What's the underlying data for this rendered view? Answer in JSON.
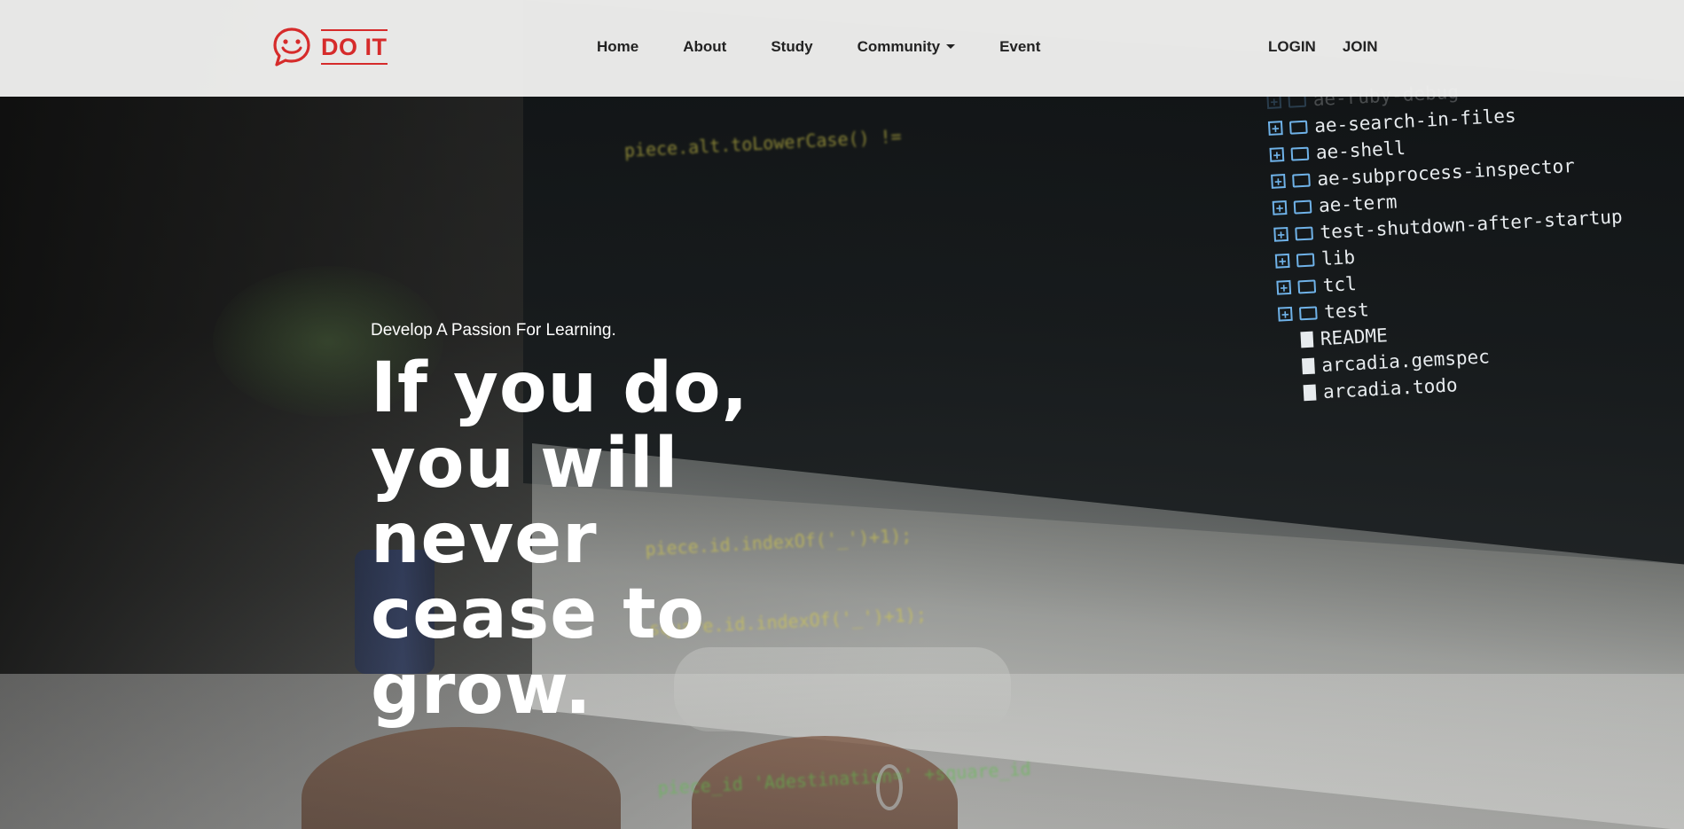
{
  "brand": {
    "name": "DO IT",
    "color": "#d62b2b"
  },
  "nav": {
    "items": [
      {
        "label": "Home"
      },
      {
        "label": "About"
      },
      {
        "label": "Study"
      },
      {
        "label": "Community",
        "has_dropdown": true
      },
      {
        "label": "Event"
      }
    ]
  },
  "auth": {
    "login_label": "LOGIN",
    "join_label": "JOIN"
  },
  "hero": {
    "tagline": "Develop A Passion For Learning.",
    "title_lines": [
      "If you do,",
      "you will",
      "never",
      "cease to",
      "grow."
    ]
  },
  "background": {
    "code_lines": [
      "piece.alt.toLowerCase() !=",
      "piece.id.indexOf('_')+1);",
      "square.id.indexOf('_')+1);",
      "piece_id 'Adestination=' +square_id"
    ],
    "file_tree": [
      {
        "label": "ae-ruby-debug",
        "type": "folder"
      },
      {
        "label": "ae-search-in-files",
        "type": "folder"
      },
      {
        "label": "ae-shell",
        "type": "folder"
      },
      {
        "label": "ae-subprocess-inspector",
        "type": "folder"
      },
      {
        "label": "ae-term",
        "type": "folder"
      },
      {
        "label": "test-shutdown-after-startup",
        "type": "folder"
      },
      {
        "label": "lib",
        "type": "folder"
      },
      {
        "label": "tcl",
        "type": "folder"
      },
      {
        "label": "test",
        "type": "folder"
      },
      {
        "label": "README",
        "type": "file"
      },
      {
        "label": "arcadia.gemspec",
        "type": "file"
      },
      {
        "label": "arcadia.todo",
        "type": "file"
      }
    ]
  }
}
